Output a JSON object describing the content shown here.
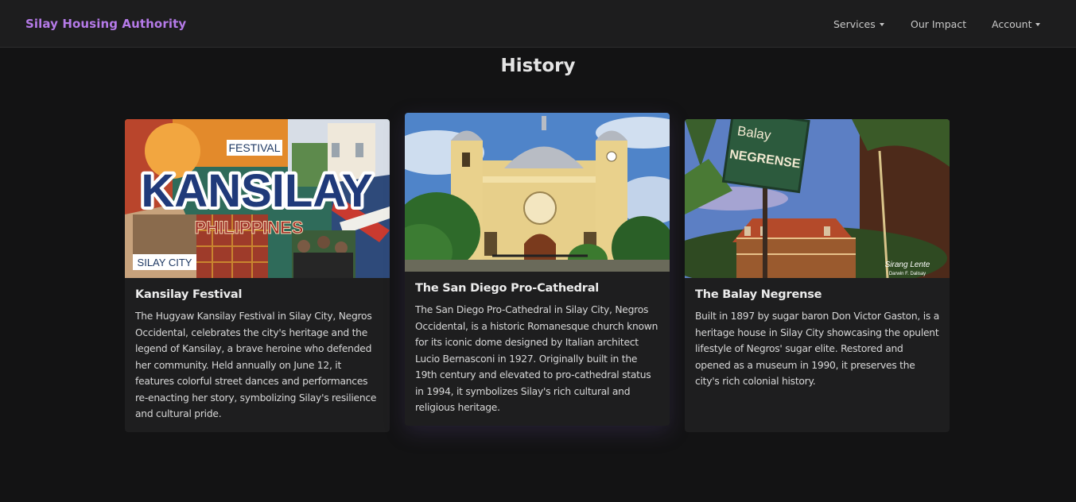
{
  "navbar": {
    "brand": "Silay Housing Authority",
    "items": [
      {
        "label": "Services",
        "dropdown": true
      },
      {
        "label": "Our Impact",
        "dropdown": false
      },
      {
        "label": "Account",
        "dropdown": true
      }
    ]
  },
  "page": {
    "title": "History"
  },
  "cards": [
    {
      "title": "Kansilay Festival",
      "text": "The Hugyaw Kansilay Festival in Silay City, Negros Occidental, celebrates the city's heritage and the legend of Kansilay, a brave heroine who defended her community. Held annually on June 12, it features colorful street dances and performances re-enacting her story, symbolizing Silay's resilience and cultural pride.",
      "image": {
        "festival": "FESTIVAL",
        "kansilay": "KANSILAY",
        "philippines": "PHILIPPINES",
        "silay_city": "SILAY CITY"
      }
    },
    {
      "title": "The San Diego Pro-Cathedral",
      "text": "The San Diego Pro-Cathedral in Silay City, Negros Occidental, is a historic Romanesque church known for its iconic dome designed by Italian architect Lucio Bernasconi in 1927. Originally built in the 19th century and elevated to pro-cathedral status in 1994, it symbolizes Silay's rich cultural and religious heritage."
    },
    {
      "title": "The Balay Negrense",
      "text": "Built in 1897 by sugar baron Don Victor Gaston, is a heritage house in Silay City showcasing the opulent lifestyle of Negros' sugar elite. Restored and opened as a museum in 1990, it preserves the city's rich colonial history.",
      "image": {
        "sign_top": "Balay",
        "sign_bottom": "NEGRENSE",
        "watermark_name": "Sirang Lente",
        "watermark_credit": "Darwin F. Dalisay"
      }
    }
  ],
  "colors": {
    "background": "#131314",
    "navbar": "#1d1d1e",
    "brand": "#b57ae8",
    "card": "#1e1e1f"
  }
}
